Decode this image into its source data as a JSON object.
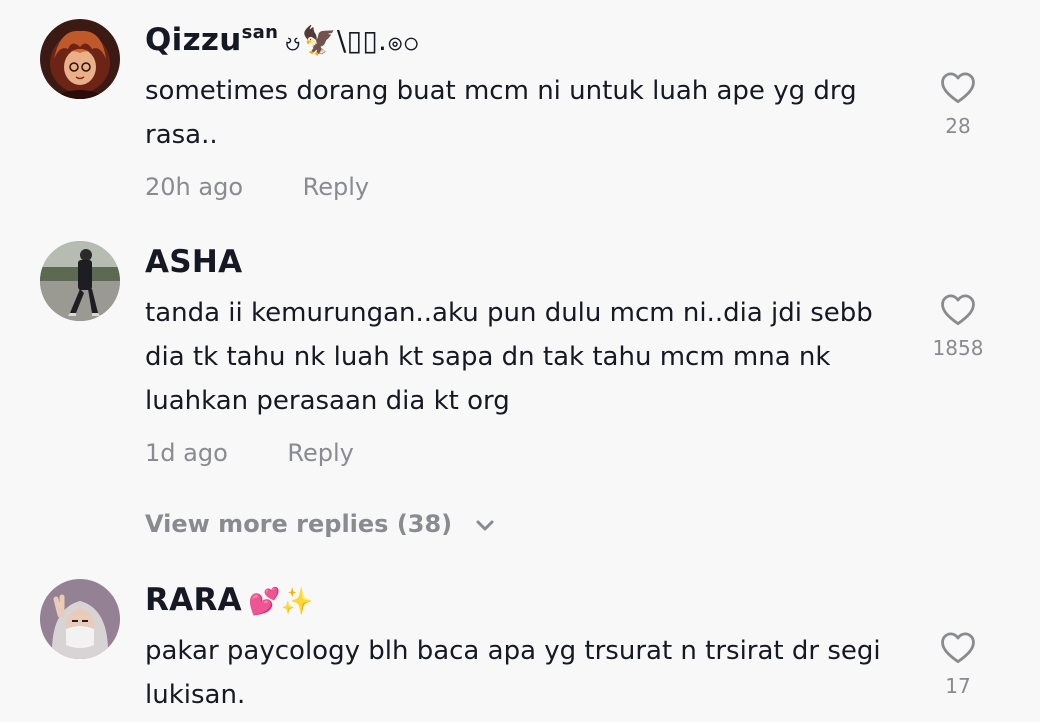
{
  "comments": [
    {
      "username": "Qizzu",
      "username_sup": "san",
      "username_deco": "ၓ🦅\\▯▯.ၜ၀",
      "text": "sometimes dorang buat mcm ni untuk luah ape yg drg rasa..",
      "time": "20h ago",
      "reply_label": "Reply",
      "likes": "28",
      "avatar_icon": "anime-avatar"
    },
    {
      "username": "ASHA",
      "text": "tanda ii kemurungan..aku pun dulu mcm ni..dia jdi sebb dia tk tahu nk luah kt sapa dn tak tahu mcm mna nk luahkan perasaan dia kt org",
      "time": "1d ago",
      "reply_label": "Reply",
      "likes": "1858",
      "avatar_icon": "person-photo-avatar",
      "view_more_label": "View more replies (38)"
    },
    {
      "username": "RARA",
      "username_emoji": "💕✨",
      "text": "pakar paycology blh baca apa yg trsurat n trsirat dr segi lukisan.",
      "likes": "17",
      "avatar_icon": "hijab-person-avatar"
    }
  ],
  "icons": {
    "like": "heart-outline-icon",
    "view_more": "chevron-down-icon"
  },
  "colors": {
    "background": "#f8f8f8",
    "primary_text": "#161823",
    "secondary_text": "#8a8b91"
  }
}
